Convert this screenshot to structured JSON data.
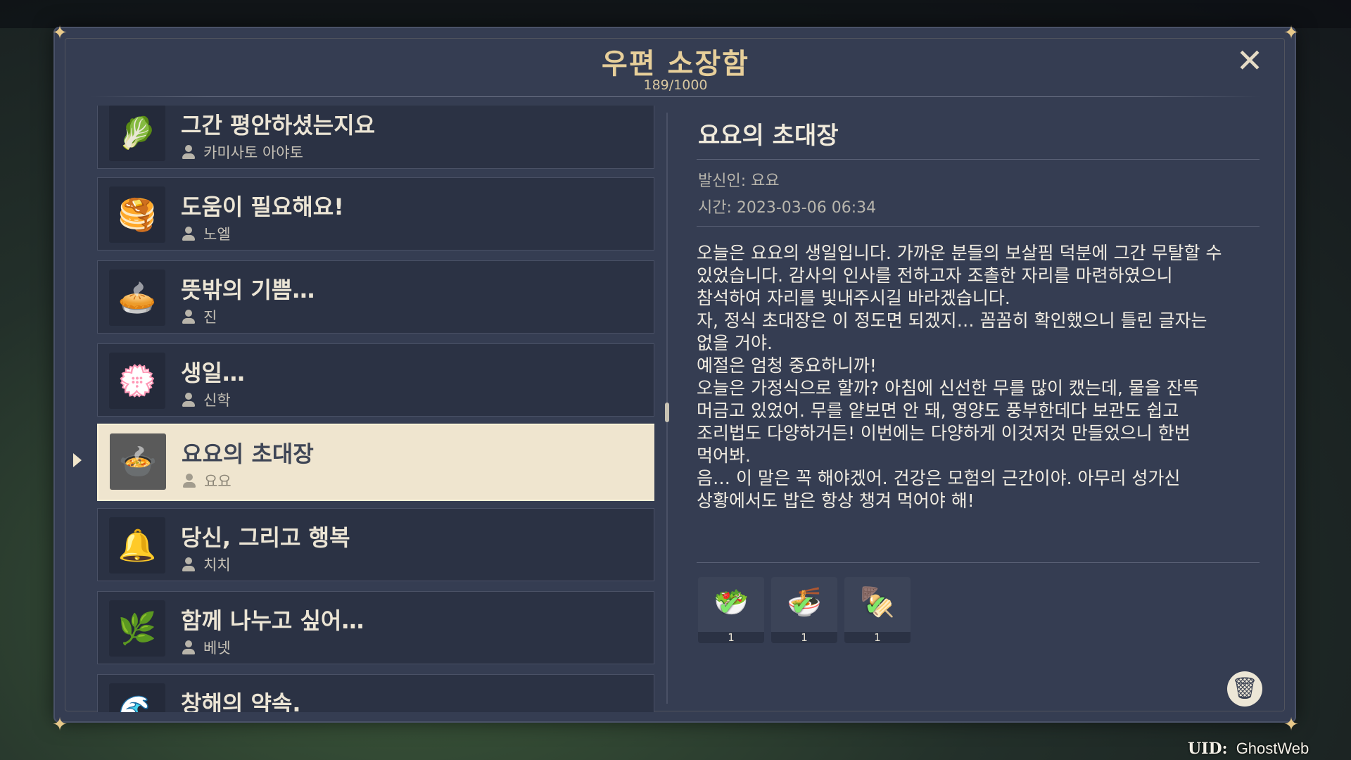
{
  "header": {
    "title": "우편 소장함",
    "count": "189/1000"
  },
  "mail_list": [
    {
      "subject": "그간 평안하셨는지요",
      "sender": "카미사토 아야토",
      "icon": "radish-icon",
      "glyph": "🥬"
    },
    {
      "subject": "도움이 필요해요!",
      "sender": "노엘",
      "icon": "pancake-icon",
      "glyph": "🥞"
    },
    {
      "subject": "뜻밖의 기쁨…",
      "sender": "진",
      "icon": "pie-icon",
      "glyph": "🥧"
    },
    {
      "subject": "생일…",
      "sender": "신학",
      "icon": "flower-icon",
      "glyph": "💮"
    },
    {
      "subject": "요요의 초대장",
      "sender": "요요",
      "icon": "dish-icon",
      "glyph": "🍲",
      "selected": true
    },
    {
      "subject": "당신, 그리고 행복",
      "sender": "치치",
      "icon": "bellflower-icon",
      "glyph": "🔔"
    },
    {
      "subject": "함께 나누고 싶어…",
      "sender": "베넷",
      "icon": "mint-icon",
      "glyph": "🌿"
    },
    {
      "subject": "창해의 약속.",
      "sender": "",
      "icon": "seahorse-icon",
      "glyph": "🌊"
    }
  ],
  "detail": {
    "title": "요요의 초대장",
    "sender_line": "발신인: 요요",
    "time_line": "시간: 2023-03-06 06:34",
    "body": "오늘은 요요의 생일입니다. 가까운 분들의 보살핌 덕분에 그간 무탈할 수\n있었습니다. 감사의 인사를 전하고자 조촐한 자리를 마련하였으니\n참석하여 자리를 빛내주시길 바라겠습니다.\n자, 정식 초대장은 이 정도면 되겠지… 꼼꼼히 확인했으니 틀린 글자는\n없을 거야.\n예절은 엄청 중요하니까!\n오늘은 가정식으로 할까? 아침에 신선한 무를 많이 캤는데, 물을 잔뜩\n머금고 있었어. 무를 얕보면 안 돼, 영양도 풍부한데다 보관도 쉽고\n조리법도 다양하거든! 이번에는 다양하게 이것저것 만들었으니 한번\n먹어봐.\n음… 이 말은 꼭 해야겠어. 건강은 모험의 근간이야. 아무리 성가신\n상황에서도 밥은 항상 챙겨 먹어야 해!"
  },
  "attachments": [
    {
      "icon": "salad-icon",
      "glyph": "🥗",
      "qty": "1",
      "claimed": true
    },
    {
      "icon": "soup-bowl-icon",
      "glyph": "🍜",
      "qty": "1",
      "claimed": true
    },
    {
      "icon": "skewer-icon",
      "glyph": "🍢",
      "qty": "1",
      "claimed": true
    }
  ],
  "footer": {
    "uid_label": "UID:",
    "uid_value": "GhostWeb"
  },
  "colors": {
    "panel": "#353d52",
    "title_gold": "#e7cf9a",
    "selected_bg": "#efe5cf"
  }
}
